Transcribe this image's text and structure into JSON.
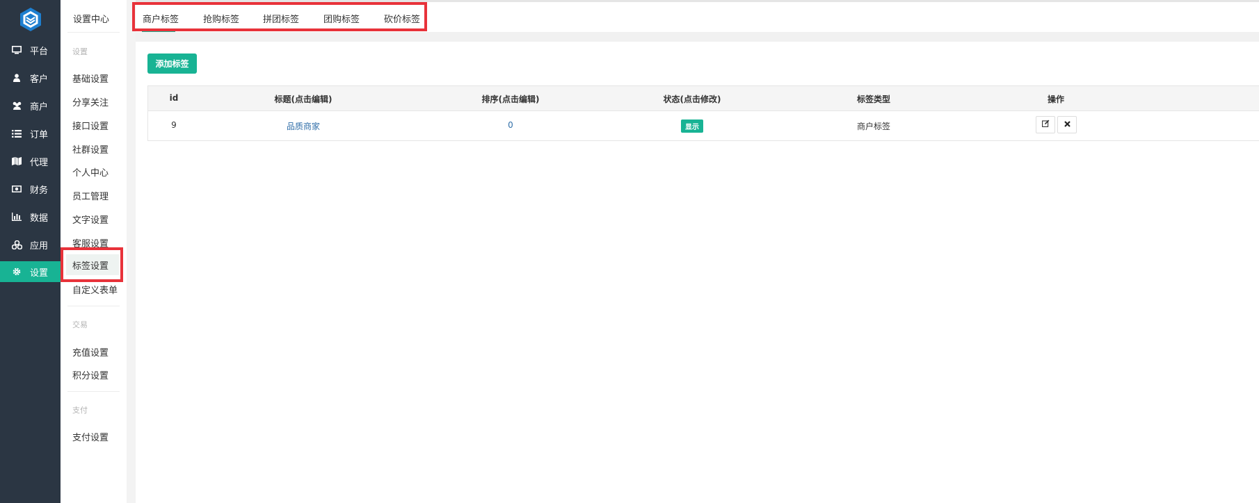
{
  "sidebar": {
    "items": [
      {
        "label": "平台",
        "icon": "monitor-icon"
      },
      {
        "label": "客户",
        "icon": "user-icon"
      },
      {
        "label": "商户",
        "icon": "users-icon"
      },
      {
        "label": "订单",
        "icon": "list-icon"
      },
      {
        "label": "代理",
        "icon": "map-icon"
      },
      {
        "label": "财务",
        "icon": "money-icon"
      },
      {
        "label": "数据",
        "icon": "bar-chart-icon"
      },
      {
        "label": "应用",
        "icon": "apps-icon"
      },
      {
        "label": "设置",
        "icon": "gear-icon",
        "active": true
      }
    ]
  },
  "subnav": {
    "title": "设置中心",
    "groups": {
      "settings": "设置",
      "trade": "交易",
      "pay": "支付"
    },
    "items": [
      "基础设置",
      "分享关注",
      "接口设置",
      "社群设置",
      "个人中心",
      "员工管理",
      "文字设置",
      "客服设置",
      "标签设置",
      "自定义表单"
    ],
    "trade_items": [
      "充值设置",
      "积分设置"
    ],
    "pay_items": [
      "支付设置"
    ]
  },
  "tabs": [
    "商户标签",
    "抢购标签",
    "拼团标签",
    "团购标签",
    "砍价标签"
  ],
  "content": {
    "add_button": "添加标签",
    "table": {
      "headers": [
        "id",
        "标题(点击编辑)",
        "排序(点击编辑)",
        "状态(点击修改)",
        "标签类型",
        "操作"
      ],
      "rows": [
        {
          "id": "9",
          "title": "品质商家",
          "sort": "0",
          "status": "显示",
          "type": "商户标签"
        }
      ]
    }
  },
  "colors": {
    "accent": "#18b394",
    "sidebar_bg": "#2b3643",
    "highlight": "#e8323a",
    "link": "#2f6ea8"
  }
}
